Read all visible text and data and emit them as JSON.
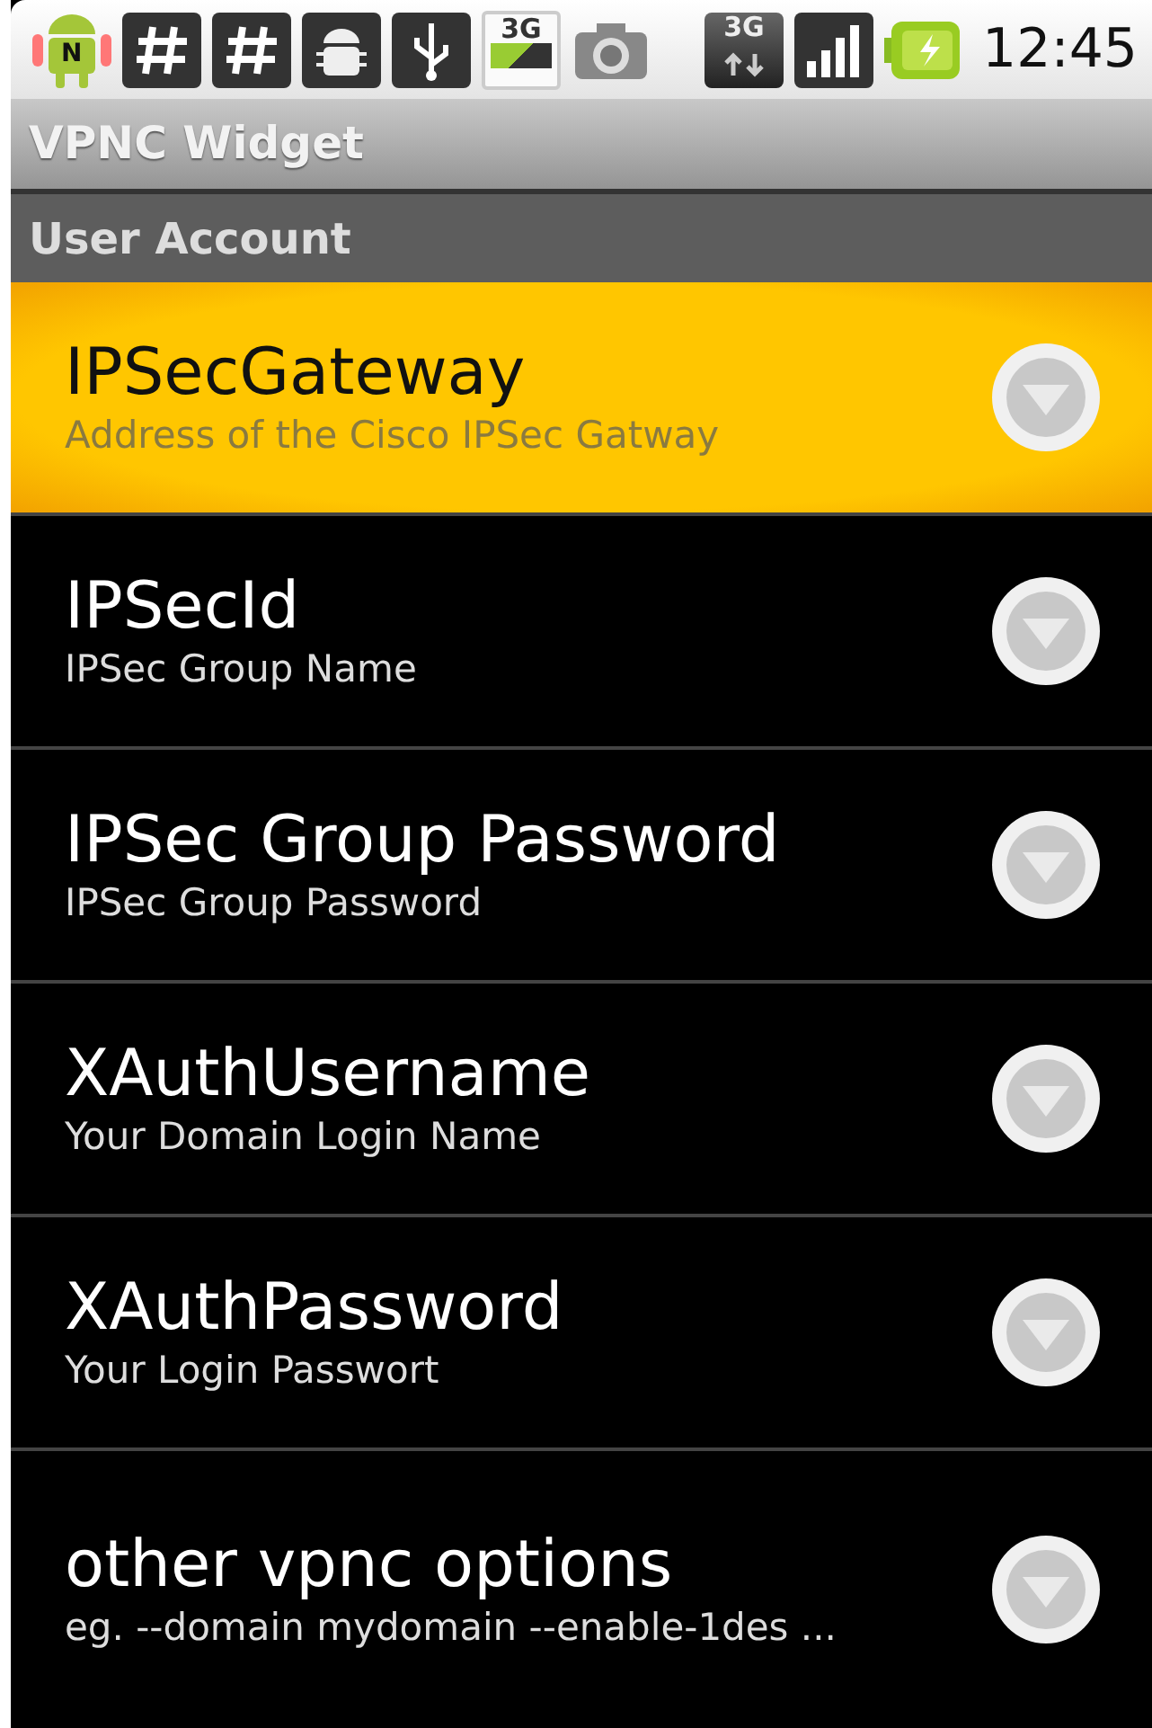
{
  "status_bar": {
    "notification_badge": "N",
    "network_badge": "3G",
    "data_badge": "3G",
    "time": "12:45"
  },
  "window": {
    "title": "VPNC Widget"
  },
  "category": {
    "title": "User Account"
  },
  "preferences": [
    {
      "title": "IPSecGateway",
      "summary": "Address of the Cisco IPSec Gatway",
      "selected": true
    },
    {
      "title": "IPSecId",
      "summary": "IPSec Group Name",
      "selected": false
    },
    {
      "title": "IPSec Group Password",
      "summary": "IPSec Group Password",
      "selected": false
    },
    {
      "title": "XAuthUsername",
      "summary": "Your Domain Login Name",
      "selected": false
    },
    {
      "title": "XAuthPassword",
      "summary": "Your Login Passwort",
      "selected": false
    },
    {
      "title": "other vpnc options",
      "summary": "eg. --domain mydomain --enable-1des ...",
      "selected": false
    }
  ]
}
